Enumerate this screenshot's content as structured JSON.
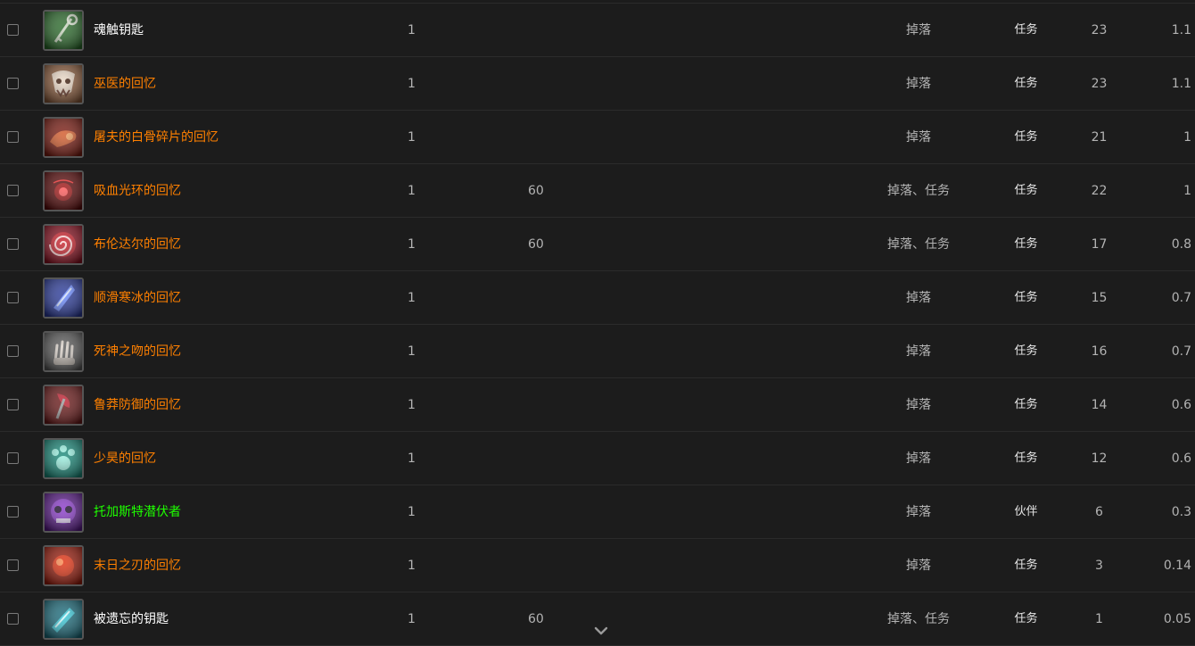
{
  "rows": [
    {
      "name": "魂触钥匙",
      "name_color": "#ffffff",
      "qty": "1",
      "level": "",
      "source": "掉落",
      "type": "任务",
      "count": "23",
      "pct": "1.1",
      "icon": "key-icon",
      "icon_color": "#2a6a2a"
    },
    {
      "name": "巫医的回忆",
      "name_color": "#ff8000",
      "qty": "1",
      "level": "",
      "source": "掉落",
      "type": "任务",
      "count": "23",
      "pct": "1.1",
      "icon": "mask-icon",
      "icon_color": "#8a5a3a"
    },
    {
      "name": "屠夫的白骨碎片的回忆",
      "name_color": "#ff8000",
      "qty": "1",
      "level": "",
      "source": "掉落",
      "type": "任务",
      "count": "21",
      "pct": "1",
      "icon": "bone-icon",
      "icon_color": "#7a1a10"
    },
    {
      "name": "吸血光环的回忆",
      "name_color": "#ff8000",
      "qty": "1",
      "level": "60",
      "source": "掉落、任务",
      "type": "任务",
      "count": "22",
      "pct": "1",
      "icon": "blood-aura-icon",
      "icon_color": "#5a0a0a"
    },
    {
      "name": "布伦达尔的回忆",
      "name_color": "#ff8000",
      "qty": "1",
      "level": "60",
      "source": "掉落、任务",
      "type": "任务",
      "count": "17",
      "pct": "0.8",
      "icon": "spiral-icon",
      "icon_color": "#8a1020"
    },
    {
      "name": "顺滑寒冰的回忆",
      "name_color": "#ff8000",
      "qty": "1",
      "level": "",
      "source": "掉落",
      "type": "任务",
      "count": "15",
      "pct": "0.7",
      "icon": "ice-icon",
      "icon_color": "#2a3a9a"
    },
    {
      "name": "死神之吻的回忆",
      "name_color": "#ff8000",
      "qty": "1",
      "level": "",
      "source": "掉落",
      "type": "任务",
      "count": "16",
      "pct": "0.7",
      "icon": "claw-hand-icon",
      "icon_color": "#5a5a5a"
    },
    {
      "name": "鲁莽防御的回忆",
      "name_color": "#ff8000",
      "qty": "1",
      "level": "",
      "source": "掉落",
      "type": "任务",
      "count": "14",
      "pct": "0.6",
      "icon": "axe-icon",
      "icon_color": "#6a1818"
    },
    {
      "name": "少昊的回忆",
      "name_color": "#ff8000",
      "qty": "1",
      "level": "",
      "source": "掉落",
      "type": "任务",
      "count": "12",
      "pct": "0.6",
      "icon": "paw-icon",
      "icon_color": "#1a8a7a"
    },
    {
      "name": "托加斯特潜伏者",
      "name_color": "#1eff00",
      "qty": "1",
      "level": "",
      "source": "掉落",
      "type": "伙伴",
      "count": "6",
      "pct": "0.3",
      "icon": "skull-creature-icon",
      "icon_color": "#5a1a8a"
    },
    {
      "name": "末日之刃的回忆",
      "name_color": "#ff8000",
      "qty": "1",
      "level": "",
      "source": "掉落",
      "type": "任务",
      "count": "3",
      "pct": "0.14",
      "icon": "orb-icon",
      "icon_color": "#9a1a0a"
    },
    {
      "name": "被遗忘的钥匙",
      "name_color": "#ffffff",
      "qty": "1",
      "level": "60",
      "source": "掉落、任务",
      "type": "任务",
      "count": "1",
      "pct": "0.05",
      "icon": "crystal-key-icon",
      "icon_color": "#1a6a7a"
    }
  ],
  "scroll": {
    "icon": "chevron-down-icon",
    "color": "#9a9a9a"
  }
}
